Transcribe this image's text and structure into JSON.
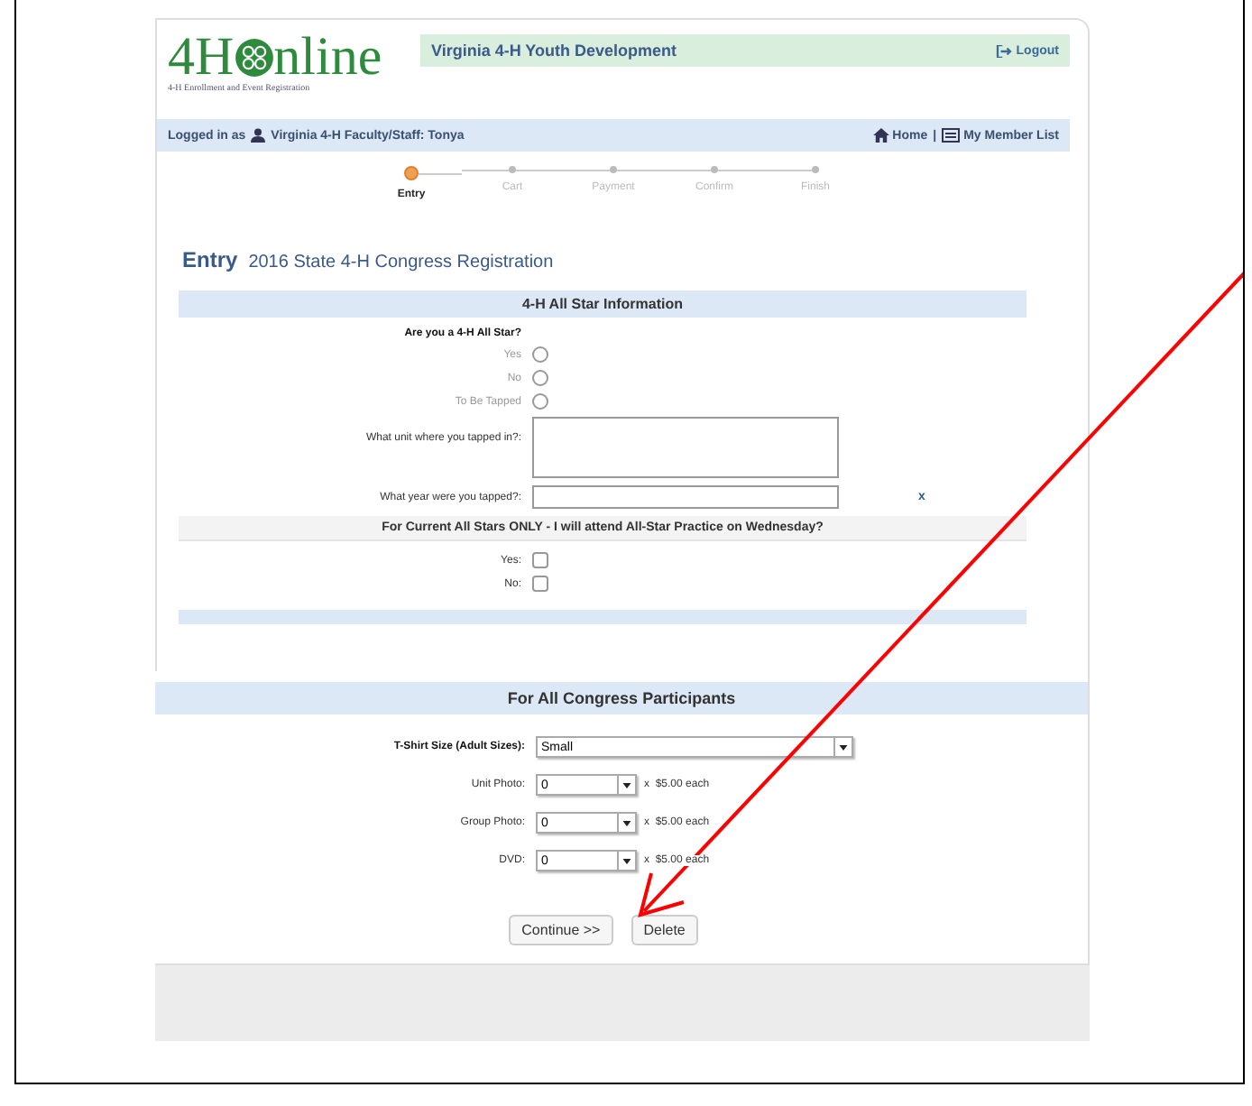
{
  "header": {
    "logo_left": "4H",
    "logo_right": "nline",
    "tagline": "4-H Enrollment and Event Registration",
    "org_title": "Virginia 4-H Youth Development",
    "logout": "Logout"
  },
  "user_bar": {
    "logged_in_label": "Logged in as",
    "user": "Virginia 4-H Faculty/Staff: Tonya",
    "home": "Home",
    "separator": "|",
    "member_list": "My Member List"
  },
  "steps": [
    {
      "label": "Entry",
      "selected": true
    },
    {
      "label": "Cart",
      "selected": false
    },
    {
      "label": "Payment",
      "selected": false
    },
    {
      "label": "Confirm",
      "selected": false
    },
    {
      "label": "Finish",
      "selected": false
    }
  ],
  "page_title": "Entry",
  "page_subtitle": "2016 State 4-H Congress Registration",
  "all_star": {
    "heading": "4-H All Star Information",
    "question": "Are you a 4-H All Star?",
    "options": [
      {
        "label": "Yes",
        "checked": false
      },
      {
        "label": "No",
        "checked": false
      },
      {
        "label": "To Be Tapped",
        "checked": false
      }
    ],
    "unit_label": "What unit where you tapped in?:",
    "year_label": "What year were you tapped?:",
    "clear": "x",
    "practice_heading": "For Current All Stars ONLY - I will attend All-Star Practice on Wednesday?",
    "practice_options": [
      {
        "label": "Yes:",
        "checked": false
      },
      {
        "label": "No:",
        "checked": false
      }
    ]
  },
  "participants": {
    "heading": "For All Congress Participants",
    "tshirt_label": "T-Shirt Size (Adult Sizes):",
    "tshirt_value": "Small",
    "items": [
      {
        "label": "Unit Photo:",
        "value": "0",
        "price": "x  $5.00 each"
      },
      {
        "label": "Group Photo:",
        "value": "0",
        "price": "x  $5.00 each"
      },
      {
        "label": "DVD:",
        "value": "0",
        "price": "x  $5.00 each"
      }
    ]
  },
  "buttons": [
    "Continue >>",
    "Delete"
  ]
}
